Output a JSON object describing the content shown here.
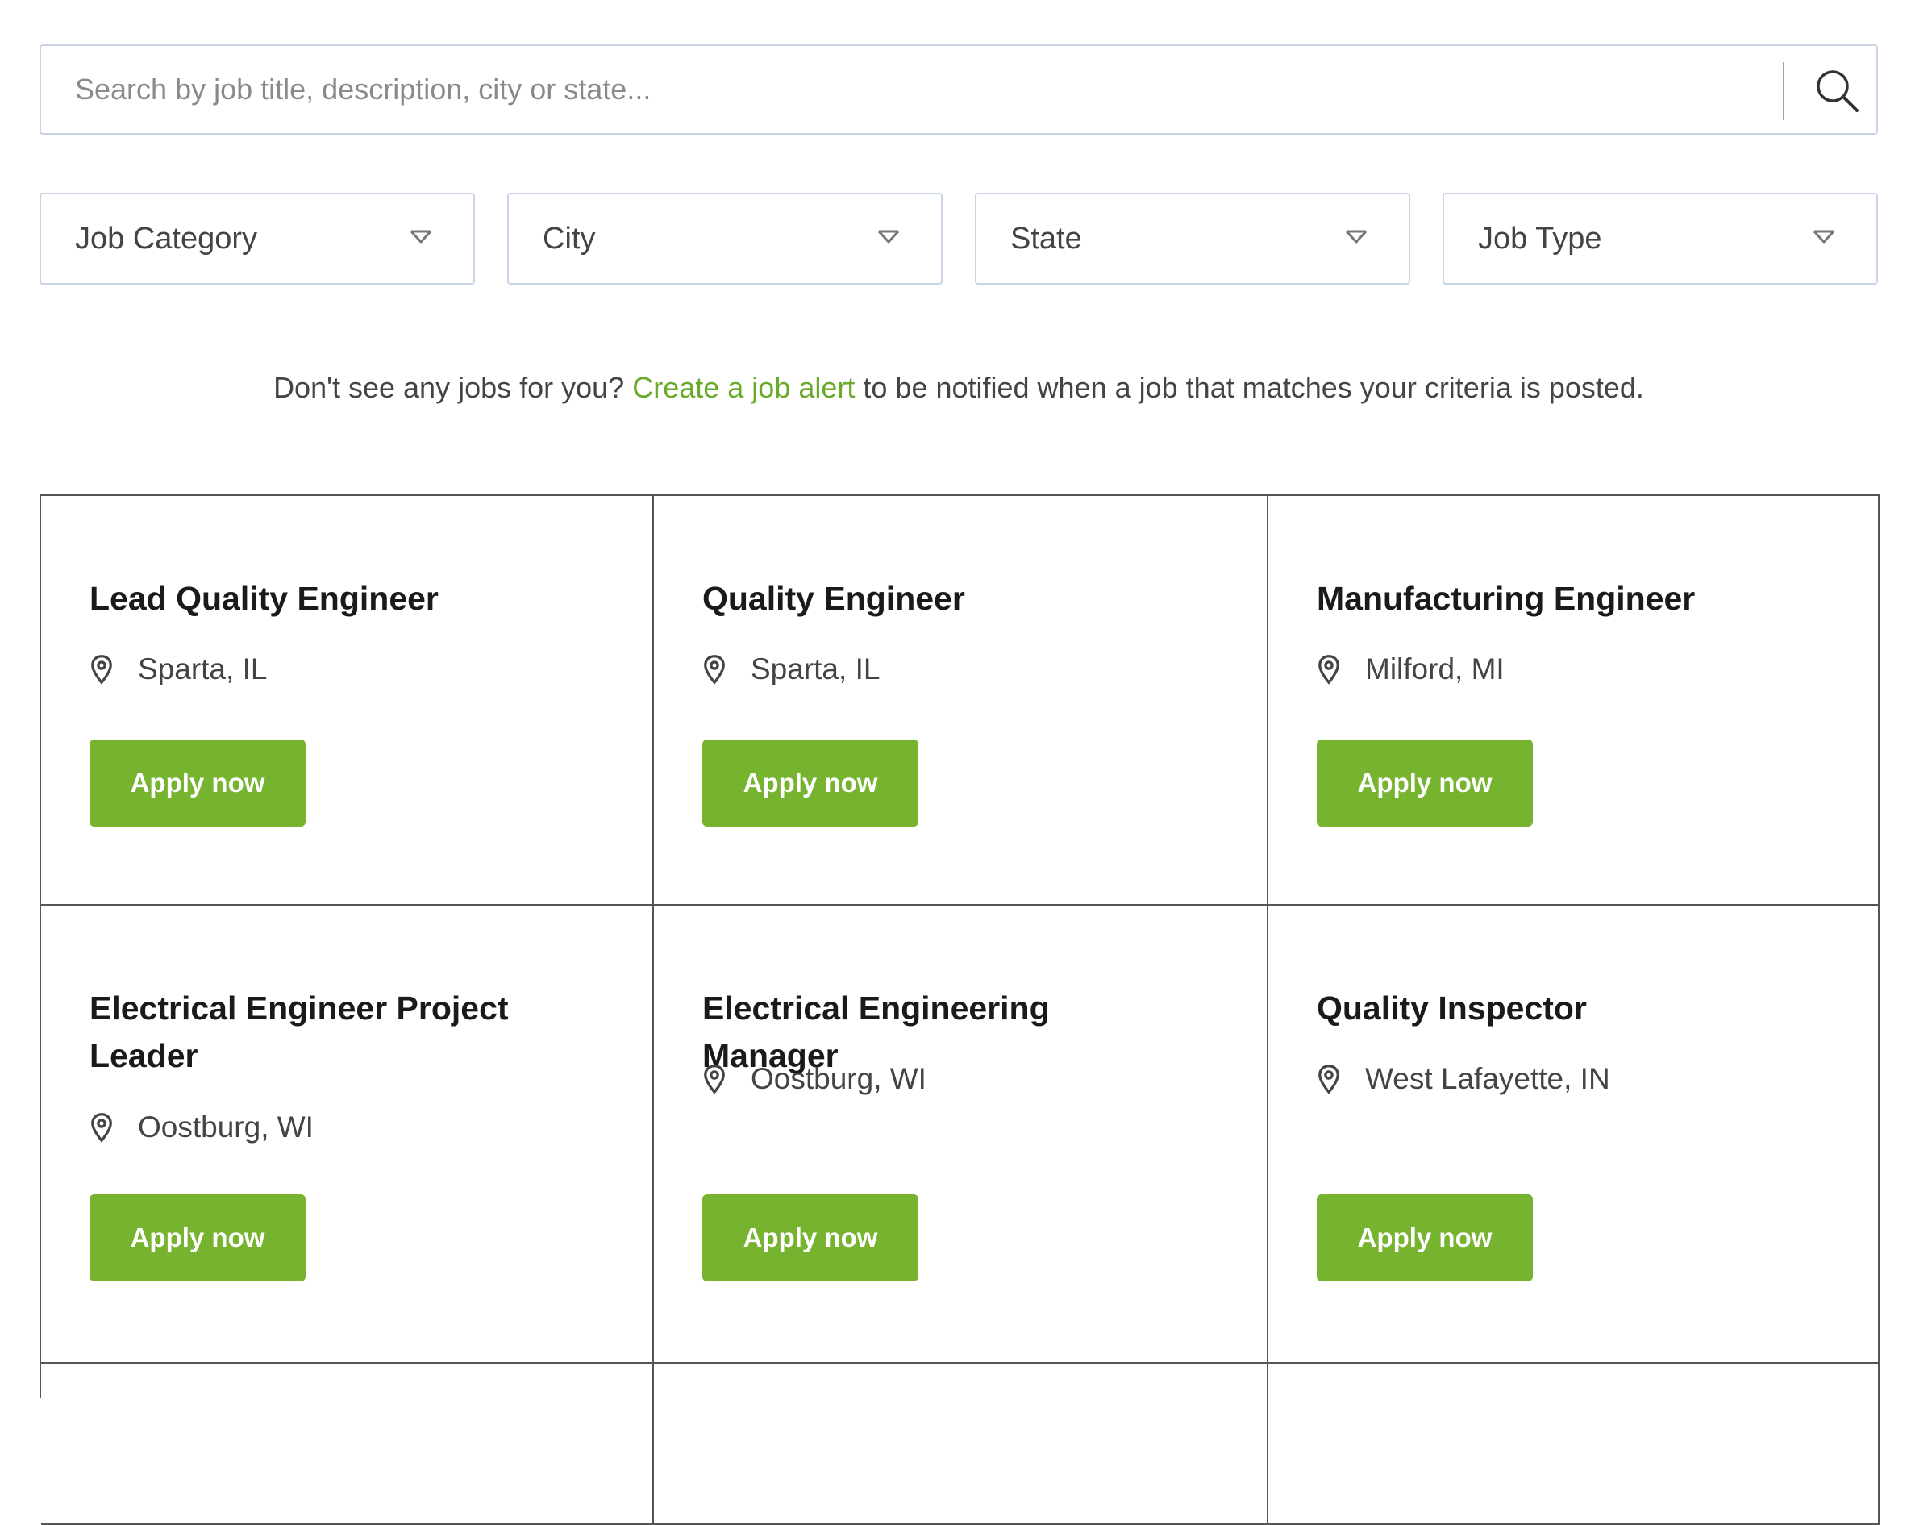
{
  "search": {
    "placeholder": "Search by job title, description, city or state...",
    "value": "",
    "icon": "search-icon"
  },
  "filters": [
    {
      "label": "Job Category",
      "icon": "chevron-down-icon"
    },
    {
      "label": "City",
      "icon": "chevron-down-icon"
    },
    {
      "label": "State",
      "icon": "chevron-down-icon"
    },
    {
      "label": "Job Type",
      "icon": "chevron-down-icon"
    }
  ],
  "alert": {
    "prefix": "Don't see any jobs for you?",
    "link": "Create a job alert",
    "suffix": "to be notified when a job that matches your criteria is posted."
  },
  "colors": {
    "accent": "#76b32f",
    "link": "#6aaa2a",
    "border": "#c9d3e6"
  },
  "jobs": [
    {
      "title": "Lead Quality Engineer",
      "location": "Sparta, IL",
      "apply_label": "Apply now"
    },
    {
      "title": "Quality Engineer",
      "location": "Sparta, IL",
      "apply_label": "Apply now"
    },
    {
      "title": "Manufacturing Engineer",
      "location": "Milford, MI",
      "apply_label": "Apply now"
    },
    {
      "title": "Electrical Engineer Project Leader",
      "location": "Oostburg, WI",
      "apply_label": "Apply now"
    },
    {
      "title": "Electrical Engineering Manager",
      "location": "Oostburg, WI",
      "apply_label": "Apply now"
    },
    {
      "title": "Quality Inspector",
      "location": "West Lafayette, IN",
      "apply_label": "Apply now"
    }
  ]
}
